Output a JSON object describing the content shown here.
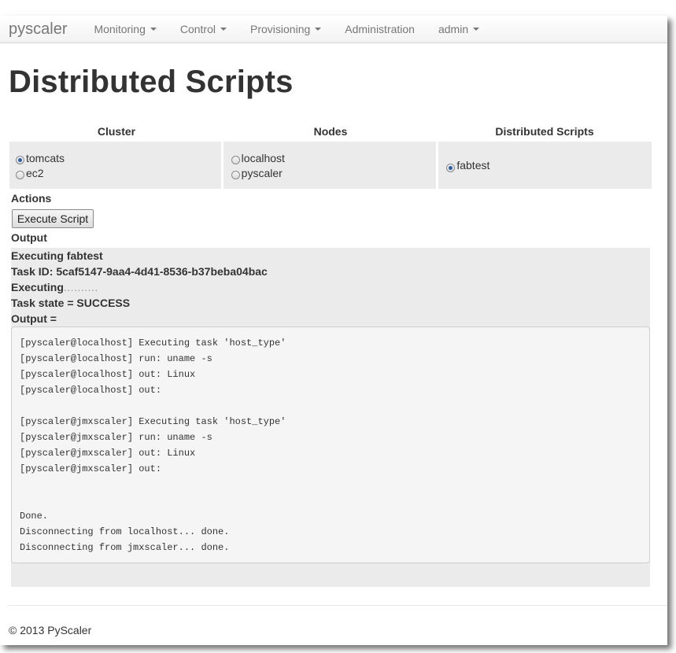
{
  "navbar": {
    "brand": "pyscaler",
    "items": [
      {
        "label": "Monitoring",
        "dropdown": true
      },
      {
        "label": "Control",
        "dropdown": true
      },
      {
        "label": "Provisioning",
        "dropdown": true
      },
      {
        "label": "Administration",
        "dropdown": false
      },
      {
        "label": "admin",
        "dropdown": true
      }
    ]
  },
  "page": {
    "title": "Distributed Scripts"
  },
  "selection": {
    "headers": [
      "Cluster",
      "Nodes",
      "Distributed Scripts"
    ],
    "cluster": [
      {
        "label": "tomcats",
        "checked": true
      },
      {
        "label": "ec2",
        "checked": false
      }
    ],
    "nodes": [
      {
        "label": "localhost",
        "checked": false
      },
      {
        "label": "pyscaler",
        "checked": false
      }
    ],
    "scripts": [
      {
        "label": "fabtest",
        "checked": true
      }
    ]
  },
  "actions": {
    "label": "Actions",
    "execute_label": "Execute Script"
  },
  "output": {
    "label": "Output",
    "executing_line": "Executing fabtest",
    "task_id_line": "Task ID: 5caf5147-9aa4-4d41-8536-b37beba04bac",
    "executing_progress": "Executing",
    "progress_dots": "..........",
    "task_state_line": "Task state = SUCCESS",
    "output_eq": "Output =",
    "log": "[pyscaler@localhost] Executing task 'host_type'\n[pyscaler@localhost] run: uname -s\n[pyscaler@localhost] out: Linux\n[pyscaler@localhost] out:\n\n[pyscaler@jmxscaler] Executing task 'host_type'\n[pyscaler@jmxscaler] run: uname -s\n[pyscaler@jmxscaler] out: Linux\n[pyscaler@jmxscaler] out:\n\n\nDone.\nDisconnecting from localhost... done.\nDisconnecting from jmxscaler... done."
  },
  "footer": {
    "copyright": "© 2013 PyScaler"
  }
}
